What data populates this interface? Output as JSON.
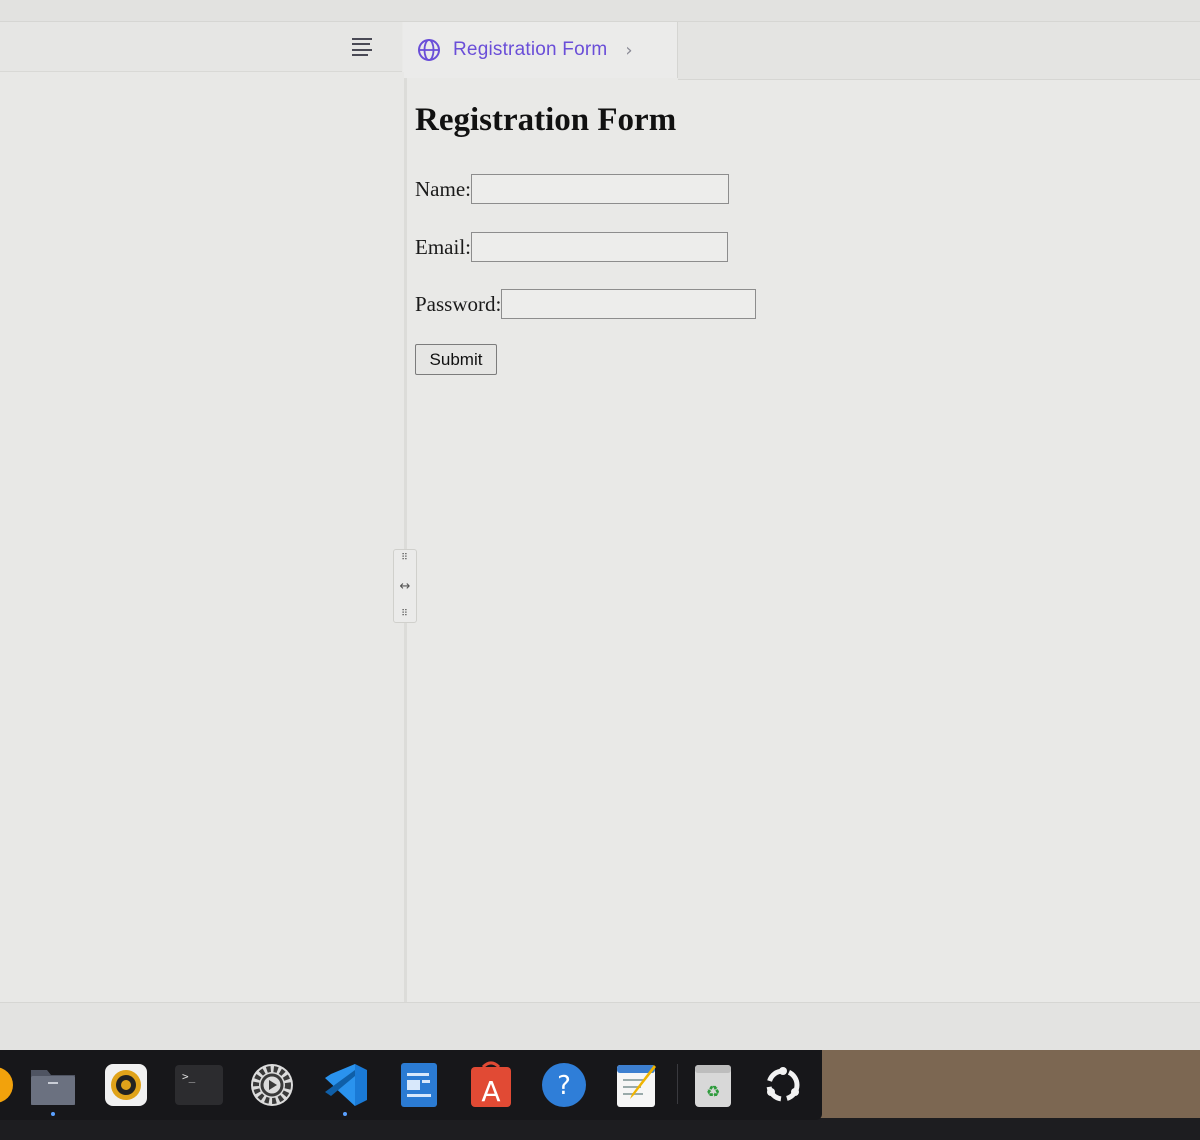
{
  "tab": {
    "label": "Registration Form"
  },
  "form": {
    "title": "Registration Form",
    "name_label": "Name:",
    "email_label": "Email:",
    "password_label": "Password:",
    "name_value": "",
    "email_value": "",
    "password_value": "",
    "submit_label": "Submit"
  },
  "colors": {
    "tab_accent": "#6a4ed8",
    "page_bg": "#e9e9e7",
    "dock_bg": "#17171a"
  },
  "dock": {
    "items": [
      {
        "name": "ubuntu-activity-icon"
      },
      {
        "name": "files-icon",
        "running": true
      },
      {
        "name": "rhythmbox-icon"
      },
      {
        "name": "terminal-icon"
      },
      {
        "name": "settings-icon"
      },
      {
        "name": "vscode-icon",
        "running": true
      },
      {
        "name": "document-viewer-icon"
      },
      {
        "name": "app-center-icon"
      },
      {
        "name": "help-icon"
      },
      {
        "name": "text-editor-icon"
      },
      {
        "name": "trash-icon"
      },
      {
        "name": "show-apps-icon"
      }
    ]
  }
}
